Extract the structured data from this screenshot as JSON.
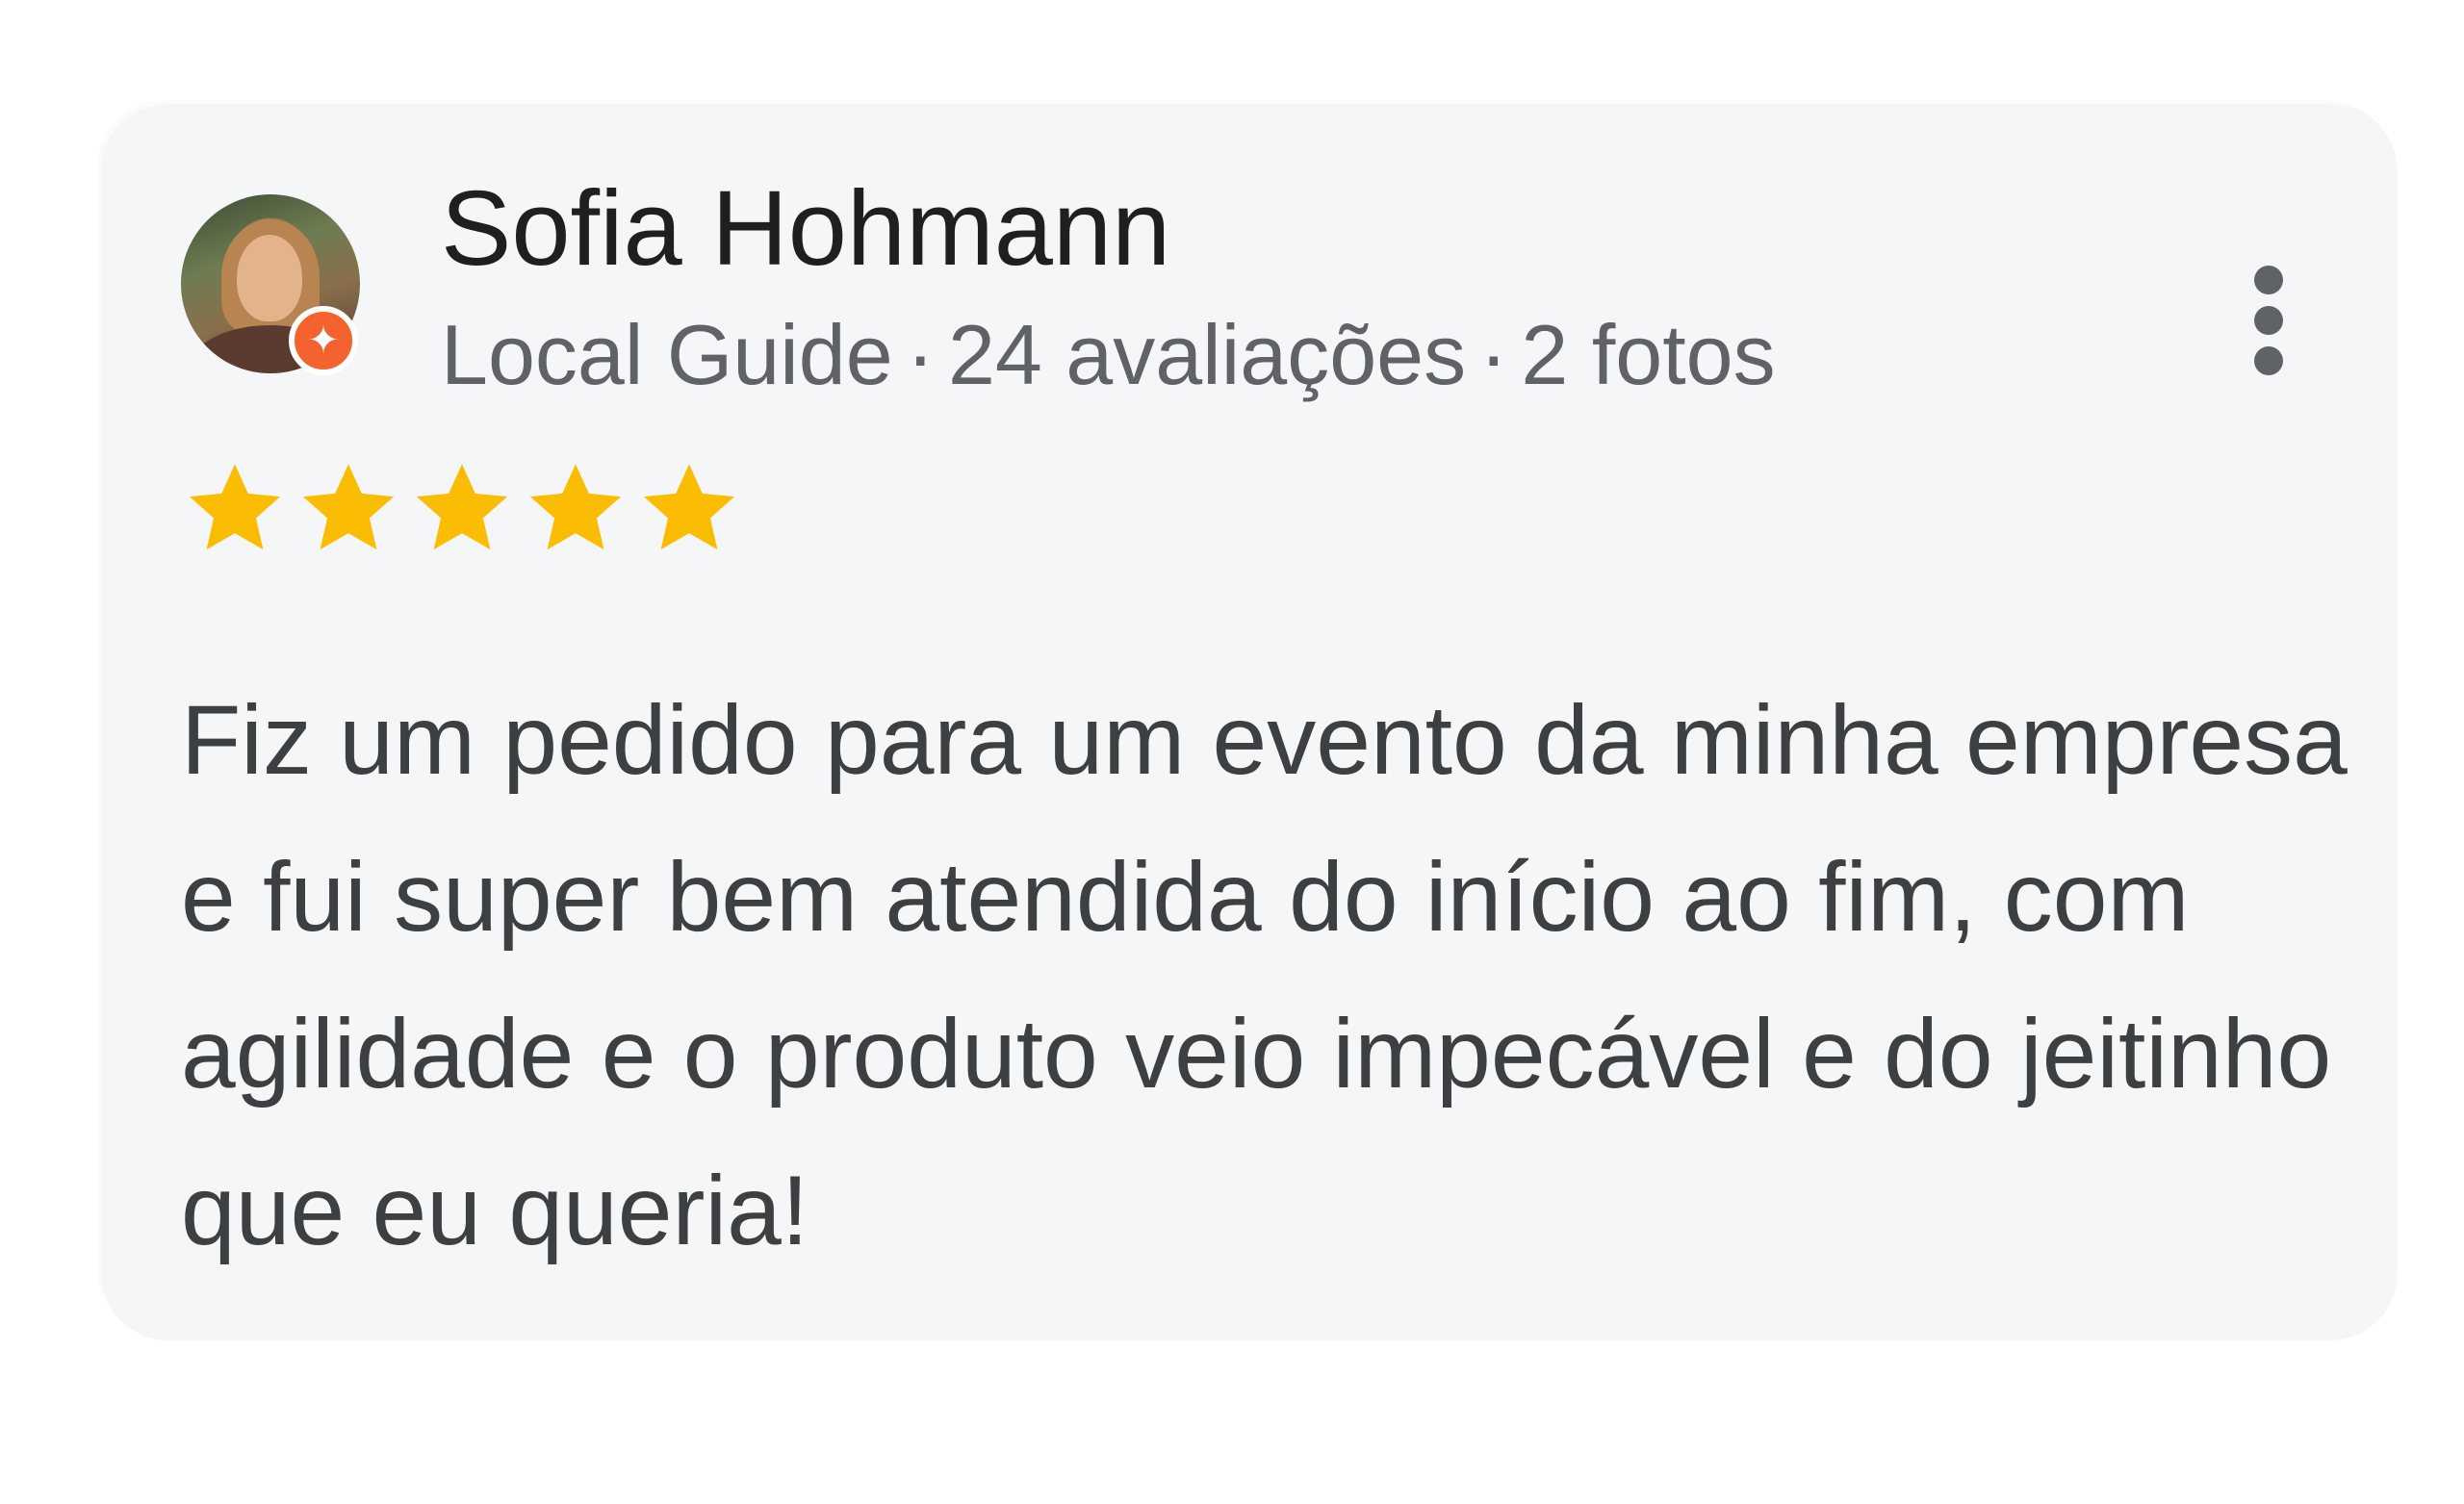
{
  "review": {
    "author_name": "Sofia Hohmann",
    "author_level": "Local Guide",
    "review_count": "24 avaliações",
    "photo_count": "2 fotos",
    "separator": "·",
    "rating": 5,
    "rating_max": 5,
    "text": "Fiz um pedido para um evento da minha empresa e fui super bem atendida do início ao fim, com agilidade e o produto veio impecável e do jeitinho que eu queria!"
  },
  "icons": {
    "badge": "local-guide-badge-icon",
    "more": "more-vert-icon",
    "star": "star-icon"
  },
  "colors": {
    "star": "#fbbc04",
    "badge": "#f4622d",
    "card_background": "#f5f6f8"
  }
}
